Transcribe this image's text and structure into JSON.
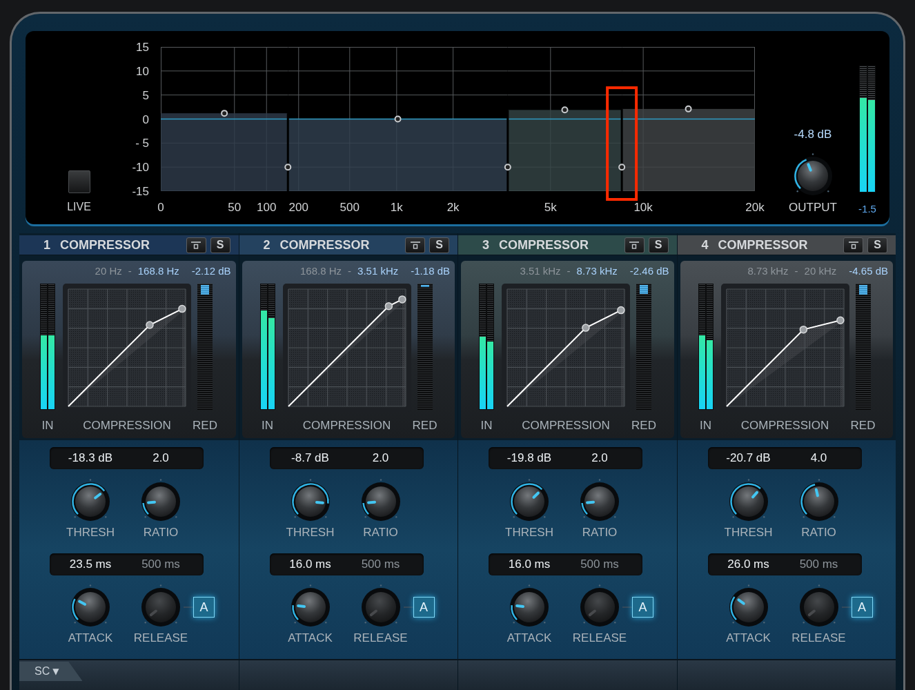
{
  "display": {
    "live_button": {
      "label": "LIVE",
      "on": false
    },
    "gain_scale": [
      "15",
      "10",
      "5",
      "0",
      "- 5",
      "-10",
      "-15"
    ],
    "frequency_scale": [
      "0",
      "50",
      "100",
      "200",
      "500",
      "1k",
      "2k",
      "5k",
      "10k",
      "20k"
    ],
    "output": {
      "readout": "-4.8 dB",
      "knob": {
        "level": 0.42
      },
      "label": "OUTPUT",
      "meter": [
        {
          "level": 0.75
        },
        {
          "level": 0.73
        }
      ],
      "meter_reading": "-1.5"
    }
  },
  "bands": [
    {
      "number": "1",
      "title": "COMPRESSOR",
      "color": "#1c3656",
      "gain_handle": {
        "level": 0.54
      },
      "solo_label": "S",
      "freq_low": "20 Hz",
      "separator": "-",
      "freq_high": {
        "text": "168.8 Hz",
        "disabled": false
      },
      "readout": "-2.12 dB",
      "in_meter": [
        {
          "level": 0.59
        },
        {
          "level": 0.59
        }
      ],
      "reduction_meter": {
        "level": 0.08
      },
      "meter_labels": {
        "input": "IN",
        "graph": "COMPRESSION",
        "reduction": "RED"
      },
      "threshold": {
        "value": "-18.3 dB",
        "label": "THRESH",
        "level": 0.694
      },
      "ratio": {
        "value": "2.0",
        "label": "RATIO",
        "level": 0.15
      },
      "attack": {
        "value": "23.5 ms",
        "label": "ATTACK",
        "level": 0.27
      },
      "release": {
        "value": "500 ms",
        "label": "RELEASE",
        "disabled": true
      },
      "auto_release": {
        "label": "A",
        "on": true
      }
    },
    {
      "number": "2",
      "title": "COMPRESSOR",
      "color": "#24425f",
      "gain_handle": {
        "level": 0.5
      },
      "crossover_handle": {
        "level": 0.214,
        "highlighted": false
      },
      "solo_label": "S",
      "freq_low": "168.8 Hz",
      "separator": "-",
      "freq_high": {
        "text": "3.51 kHz",
        "disabled": false
      },
      "readout": "-1.18 dB",
      "in_meter": [
        {
          "level": 0.79
        },
        {
          "level": 0.73
        }
      ],
      "reduction_meter": {
        "level": 0.015
      },
      "meter_labels": {
        "input": "IN",
        "graph": "COMPRESSION",
        "reduction": "RED"
      },
      "threshold": {
        "value": "-8.7 dB",
        "label": "THRESH",
        "level": 0.855
      },
      "ratio": {
        "value": "2.0",
        "label": "RATIO",
        "level": 0.15
      },
      "attack": {
        "value": "16.0 ms",
        "label": "ATTACK",
        "level": 0.19
      },
      "release": {
        "value": "500 ms",
        "label": "RELEASE",
        "disabled": true
      },
      "auto_release": {
        "label": "A",
        "on": true
      }
    },
    {
      "number": "3",
      "title": "COMPRESSOR",
      "color": "#2d4b4a",
      "gain_handle": {
        "level": 0.563
      },
      "crossover_handle": {
        "level": 0.584,
        "highlighted": false
      },
      "solo_label": "S",
      "freq_low": "3.51 kHz",
      "separator": "-",
      "freq_high": {
        "text": "8.73 kHz",
        "disabled": false
      },
      "readout": "-2.46 dB",
      "in_meter": [
        {
          "level": 0.58
        },
        {
          "level": 0.54
        }
      ],
      "reduction_meter": {
        "level": 0.07
      },
      "meter_labels": {
        "input": "IN",
        "graph": "COMPRESSION",
        "reduction": "RED"
      },
      "threshold": {
        "value": "-19.8 dB",
        "label": "THRESH",
        "level": 0.67
      },
      "ratio": {
        "value": "2.0",
        "label": "RATIO",
        "level": 0.15
      },
      "attack": {
        "value": "16.0 ms",
        "label": "ATTACK",
        "level": 0.19
      },
      "release": {
        "value": "500 ms",
        "label": "RELEASE",
        "disabled": true
      },
      "auto_release": {
        "label": "A",
        "on": true
      }
    },
    {
      "number": "4",
      "title": "COMPRESSOR",
      "color": "#46494c",
      "gain_handle": {
        "level": 0.57
      },
      "crossover_handle": {
        "level": 0.776,
        "highlighted": true
      },
      "solo_label": "S",
      "freq_low": "8.73 kHz",
      "separator": "-",
      "freq_high": {
        "text": "20 kHz",
        "disabled": true
      },
      "readout": "-4.65 dB",
      "in_meter": [
        {
          "level": 0.59
        },
        {
          "level": 0.55
        }
      ],
      "reduction_meter": {
        "level": 0.08
      },
      "meter_labels": {
        "input": "IN",
        "graph": "COMPRESSION",
        "reduction": "RED"
      },
      "threshold": {
        "value": "-20.7 dB",
        "label": "THRESH",
        "level": 0.655
      },
      "ratio": {
        "value": "4.0",
        "label": "RATIO",
        "level": 0.45
      },
      "attack": {
        "value": "26.0 ms",
        "label": "ATTACK",
        "level": 0.3
      },
      "release": {
        "value": "500 ms",
        "label": "RELEASE",
        "disabled": true
      },
      "auto_release": {
        "label": "A",
        "on": true
      }
    }
  ],
  "footer": {
    "sidechain": {
      "label": "SC",
      "arrow": "▼"
    }
  }
}
